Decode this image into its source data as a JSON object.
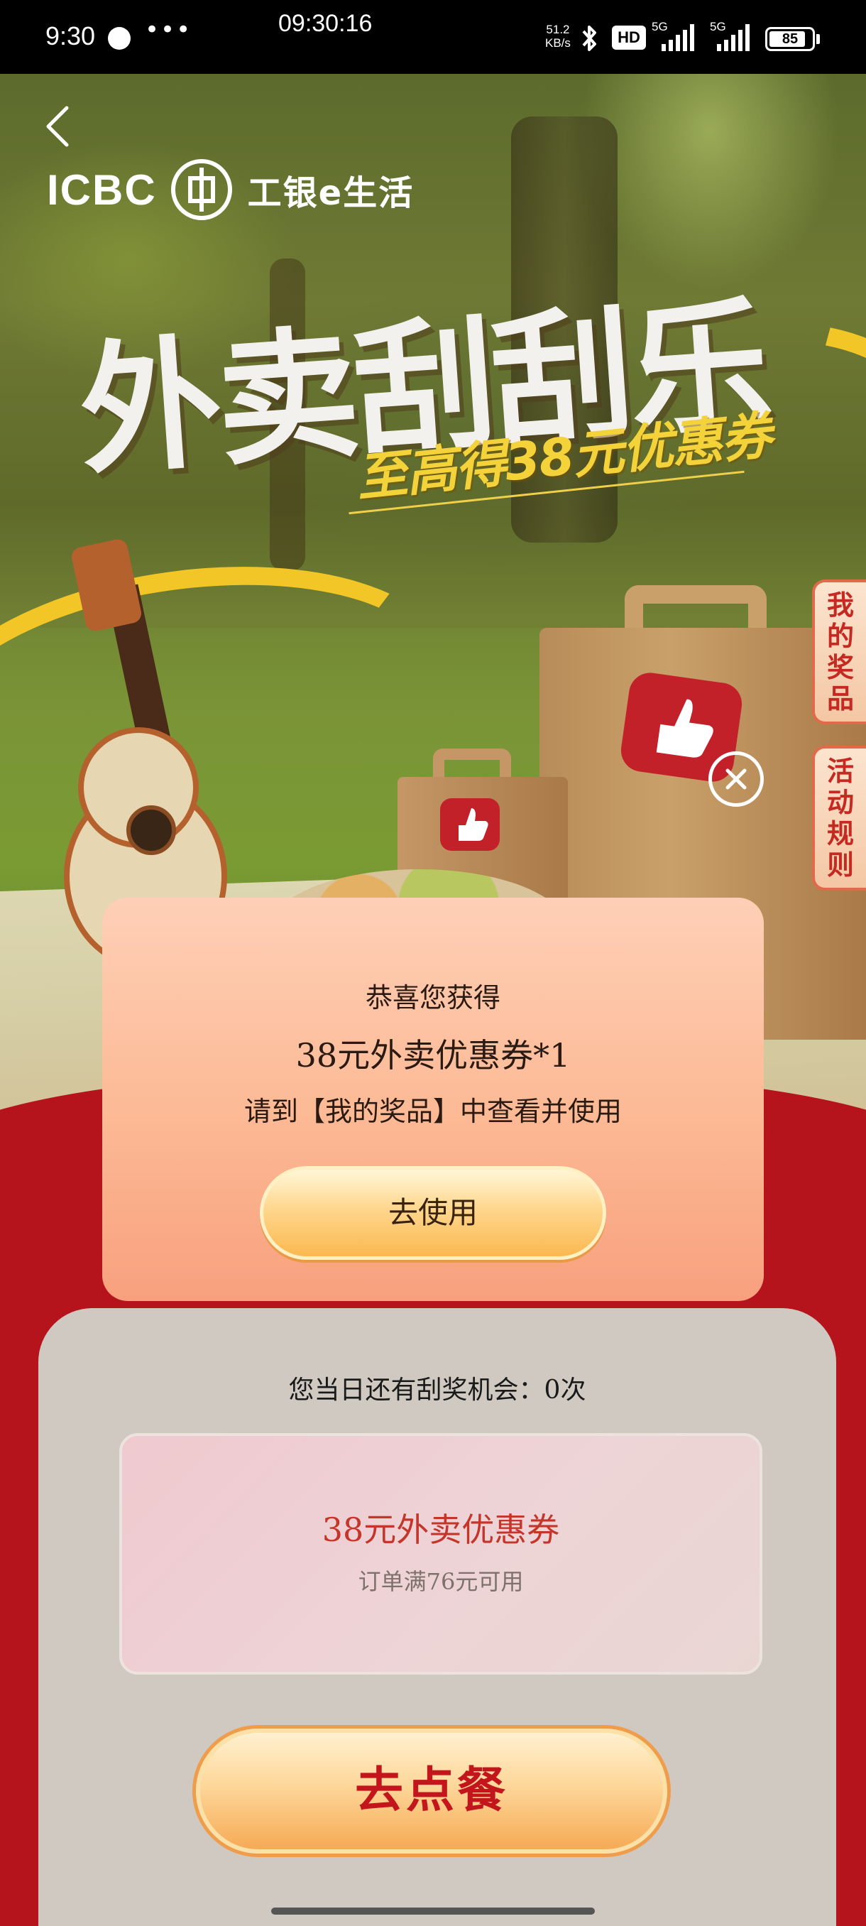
{
  "status_bar": {
    "time": "9:30",
    "clock": "09:30:16",
    "network_speed_value": "51.2",
    "network_speed_unit": "KB/s",
    "hd_label": "HD",
    "sim1_label": "5G",
    "sim2_label": "5G",
    "battery_level": "85"
  },
  "header": {
    "logo_en": "ICBC",
    "logo_cn": "工银e生活"
  },
  "hero": {
    "title": "外卖刮刮乐",
    "subtitle": "至高得38元优惠券"
  },
  "side_tabs": {
    "my_prizes": "我的奖品",
    "rules": "活动规则"
  },
  "popup": {
    "congrats": "恭喜您获得",
    "prize": "38元外卖优惠券*1",
    "hint": "请到【我的奖品】中查看并使用",
    "use_button": "去使用"
  },
  "panel": {
    "chances": "您当日还有刮奖机会：0次",
    "coupon_title": "38元外卖优惠券",
    "coupon_condition": "订单满76元可用",
    "order_button": "去点餐"
  },
  "colors": {
    "brand_red": "#b5141c",
    "popup_peach": "#fcb994",
    "accent_gold": "#f2c626"
  }
}
